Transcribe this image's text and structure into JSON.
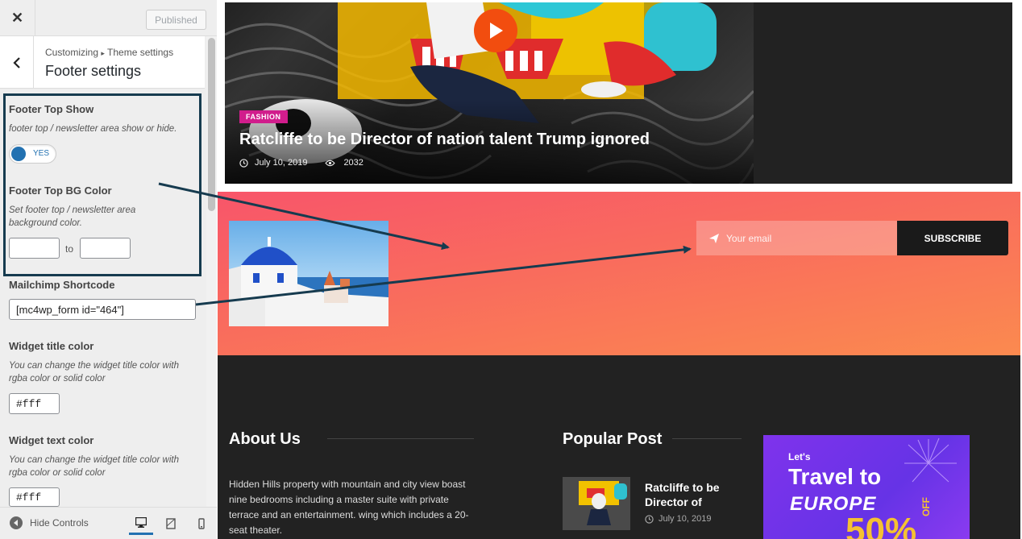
{
  "customizer": {
    "close_icon": "close-icon",
    "published_label": "Published",
    "breadcrumb_parent": "Customizing",
    "breadcrumb_sep": "▸",
    "breadcrumb_child": "Theme settings",
    "section_title": "Footer settings",
    "controls": {
      "footer_top_show": {
        "title": "Footer Top Show",
        "desc": "footer top / newsletter area show or hide.",
        "toggle_label": "YES",
        "enabled": true
      },
      "footer_top_bg": {
        "title": "Footer Top BG Color",
        "desc": "Set footer top / newsletter area background color.",
        "from_value": "",
        "to_label": "to",
        "to_value": ""
      },
      "mailchimp": {
        "title": "Mailchimp Shortcode",
        "value": "[mc4wp_form id=\"464\"]"
      },
      "widget_title_color": {
        "title": "Widget title color",
        "desc": "You can change the widget title color with rgba color or solid color",
        "value": "#fff"
      },
      "widget_text_color": {
        "title": "Widget text color",
        "desc": "You can change the widget title color with rgba color or solid color",
        "value": "#fff"
      }
    },
    "footer": {
      "hide_controls_label": "Hide Controls"
    }
  },
  "preview": {
    "hero": {
      "tag": "FASHION",
      "title": "Ratcliffe to be Director of nation talent Trump ignored",
      "date": "July 10, 2019",
      "views": "2032"
    },
    "newsletter": {
      "email_placeholder": "Your email",
      "subscribe_label": "SUBSCRIBE"
    },
    "footer": {
      "about_title": "About Us",
      "about_text": "Hidden Hills property with mountain and city view boast nine bedrooms including a master suite with private terrace and an entertainment. wing which includes a 20-seat theater.",
      "popular_title": "Popular Post",
      "post_title": "Ratcliffe to be Director of",
      "post_date": "July 10, 2019",
      "ad": {
        "lets": "Let's",
        "travel": "Travel to",
        "europe": "EUROPE",
        "discount": "50%",
        "off": "OFF"
      }
    }
  },
  "colors": {
    "accent": "#2271b1",
    "highlight_border": "#163b4f",
    "play_button": "#f24d0f",
    "tag_pink": "#d11d8c",
    "newsletter_gradient_start": "#f8556a",
    "newsletter_gradient_end": "#fb8a4f",
    "footer_bg": "#222222"
  }
}
